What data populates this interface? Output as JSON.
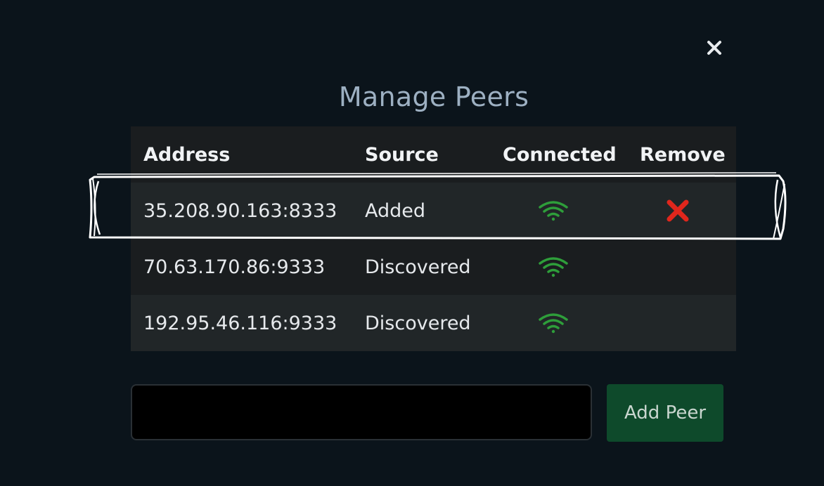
{
  "dialog": {
    "title": "Manage Peers",
    "close_icon": "close-icon"
  },
  "table": {
    "headers": {
      "address": "Address",
      "source": "Source",
      "connected": "Connected",
      "remove": "Remove"
    },
    "rows": [
      {
        "address": "35.208.90.163:8333",
        "source": "Added",
        "connected": true,
        "removable": true
      },
      {
        "address": "70.63.170.86:9333",
        "source": "Discovered",
        "connected": true,
        "removable": false
      },
      {
        "address": "192.95.46.116:9333",
        "source": "Discovered",
        "connected": true,
        "removable": false
      }
    ]
  },
  "add_peer": {
    "input_value": "",
    "button_label": "Add Peer"
  },
  "colors": {
    "background": "#0b141b",
    "title": "#9db0c2",
    "table_row": "#1a1d1f",
    "table_row_alt": "#212628",
    "wifi_icon": "#2e9e3a",
    "remove_icon": "#e0261c",
    "add_button": "#0e4a2b"
  },
  "icons": {
    "connected": "wifi-icon",
    "remove": "red-x-icon"
  }
}
